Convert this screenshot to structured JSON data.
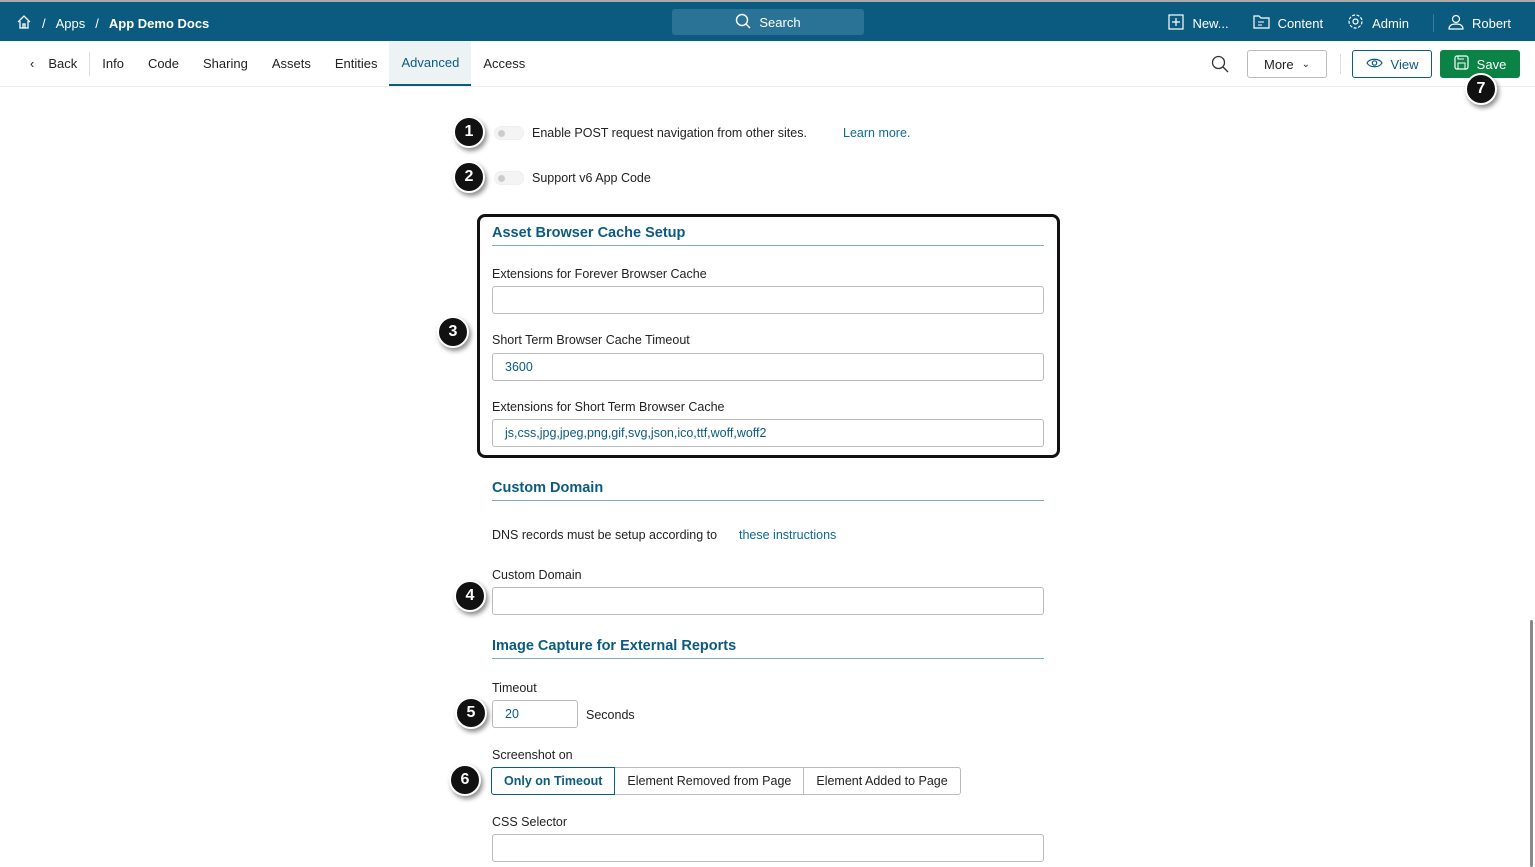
{
  "header": {
    "breadcrumb": [
      "Apps",
      "App Demo Docs"
    ],
    "search": "Search",
    "nav": [
      "New...",
      "Content",
      "Admin",
      "Robert"
    ]
  },
  "tabs": {
    "back": "Back",
    "items": [
      "Info",
      "Code",
      "Sharing",
      "Assets",
      "Entities",
      "Advanced",
      "Access"
    ],
    "active": "Advanced"
  },
  "toolbar": {
    "more": "More",
    "view": "View",
    "save": "Save"
  },
  "settings": {
    "post_nav": "Enable POST request navigation from other sites.",
    "learn_more": "Learn more.",
    "v6": "Support v6 App Code"
  },
  "cache": {
    "title": "Asset Browser Cache Setup",
    "forever_label": "Extensions for Forever Browser Cache",
    "forever_value": "",
    "timeout_label": "Short Term Browser Cache Timeout",
    "timeout_value": "3600",
    "short_label": "Extensions for Short Term Browser Cache",
    "short_value": "js,css,jpg,jpeg,png,gif,svg,json,ico,ttf,woff,woff2"
  },
  "domain": {
    "title": "Custom Domain",
    "dns_text": "DNS records must be setup according to",
    "dns_link": "these instructions",
    "label": "Custom Domain",
    "value": ""
  },
  "capture": {
    "title": "Image Capture for External Reports",
    "timeout_label": "Timeout",
    "timeout_value": "20",
    "seconds": "Seconds",
    "screenshot_label": "Screenshot on",
    "options": [
      "Only on Timeout",
      "Element Removed from Page",
      "Element Added to Page"
    ],
    "selected": "Only on Timeout",
    "css_label": "CSS Selector",
    "css_value": ""
  },
  "callouts": [
    "1",
    "2",
    "3",
    "4",
    "5",
    "6",
    "7"
  ],
  "colors": {
    "brand": "#0b5b80",
    "save": "#0a8345"
  }
}
